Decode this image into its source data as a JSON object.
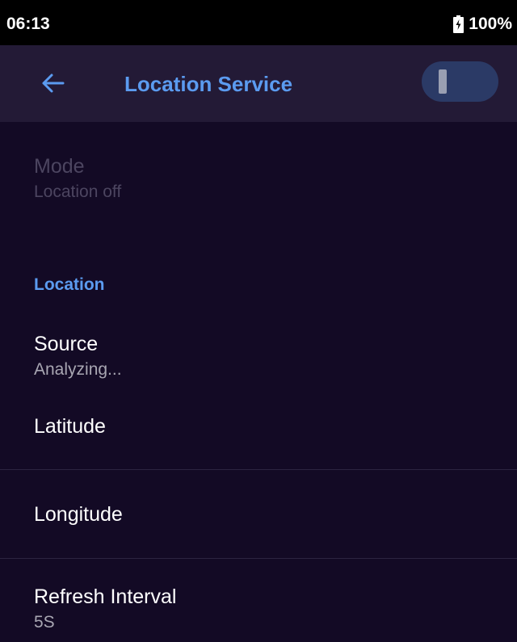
{
  "status_bar": {
    "time": "06:13",
    "battery": "100%"
  },
  "app_bar": {
    "title": "Location Service",
    "toggle_on": false
  },
  "mode": {
    "title": "Mode",
    "value": "Location off"
  },
  "section": {
    "header": "Location"
  },
  "items": {
    "source": {
      "title": "Source",
      "value": "Analyzing..."
    },
    "latitude": {
      "title": "Latitude"
    },
    "longitude": {
      "title": "Longitude"
    },
    "refresh": {
      "title": "Refresh Interval",
      "value": "5S"
    }
  },
  "colors": {
    "accent": "#5b9bf0",
    "background": "#130a25",
    "app_bar": "#231a36",
    "toggle_track": "#2b3a66"
  }
}
